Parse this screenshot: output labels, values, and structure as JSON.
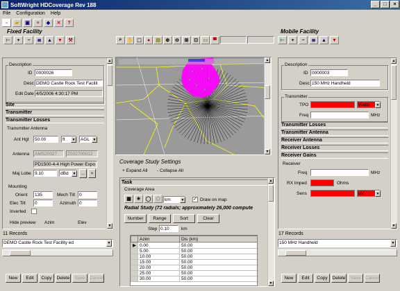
{
  "window": {
    "title": "SoftWright HDCoverage Rev 188"
  },
  "menu": [
    {
      "label": "File"
    },
    {
      "label": "Configuration"
    },
    {
      "label": "Help"
    }
  ],
  "fixed": {
    "title": "Fixed Facility",
    "desc_group": "Description",
    "id_label": "ID",
    "id": "0000026",
    "desc_label": "Desc",
    "desc": "DEMO Castle Rock Test Facilit",
    "edit_label": "Edit Date",
    "edit": "4/5/2006 4:30:17 PM",
    "site": "Site",
    "transmitter": "Transmitter",
    "losses": "Transmitter Losses",
    "antenna_group": "Transmitter Antenna",
    "anthgt_label": "Ant Hgt",
    "anthgt": "50.00",
    "anthgt_unit": "ft",
    "anthgt_ref": "AGL",
    "antenna_label": "Antenna",
    "antenna_a": "AMS20027",
    "antenna_b": "Z002700012",
    "antenna_model": "PD1500-4-4 High Power Expo",
    "majlobe_label": "Maj Lobe",
    "majlobe": "9.10",
    "majlobe_unit": "dBd",
    "mounting": "Mounting",
    "orient_label": "Orient",
    "orient": "135",
    "mechtilt_label": "Mech Tilt",
    "mechtilt": "0",
    "electilt_label": "Elec Tilt",
    "electilt": "0",
    "azimuth_label": "Azimuth",
    "azimuth": "0",
    "inverted": "Inverted",
    "hidepreview": "Hide preview",
    "azim": "Azim",
    "elev": "Elev",
    "records": "11 Records",
    "selected": "DEMO Castle Rock Test Facility ed"
  },
  "mobile": {
    "title": "Mobile Facility",
    "desc_group": "Description",
    "id_label": "ID",
    "id": "0000003",
    "desc_label": "Desc",
    "desc": "150 MHz Handheld",
    "tx_group": "Transmitter",
    "tpo_label": "TPO",
    "tpo_unit": "Watts",
    "freq_label": "Freq",
    "freq_unit": "MHz",
    "tx_losses": "Transmitter Losses",
    "tx_antenna": "Transmitter Antenna",
    "rx_antenna": "Receiver Antenna",
    "rx_losses": "Receiver Losses",
    "rx_gains": "Receiver Gains",
    "rx_group": "Receiver",
    "rxfreq_label": "Freq",
    "rxfreq_unit": "MHz",
    "rximped_label": "RX Imped",
    "rximped_unit": "Ohms",
    "sens_label": "Sens",
    "sens_unit": "uV",
    "records": "17 Records",
    "selected": "150 MHz Handheld"
  },
  "buttons": {
    "new": "New",
    "edit": "Edit",
    "copy": "Copy",
    "delete": "Delete",
    "save": "Save",
    "cancel": "Cancel"
  },
  "study": {
    "title": "Coverage Study Settings",
    "expand": "Expand All",
    "collapse": "Collapse All",
    "task": "Task",
    "area": "Coverage Area",
    "unit": "km",
    "draw": "Draw on map",
    "radial": "Radial Study (72 radials; approximately 26,000 compute",
    "number": "Number",
    "range": "Range",
    "sort": "Sort",
    "clear": "Clear",
    "step_label": "Step",
    "step": "0.10",
    "step_unit": "km",
    "col_azim": "Azim",
    "col_dis": "Dis (km)",
    "rows": [
      [
        "0.00",
        "50.00"
      ],
      [
        "5.00",
        "50.00"
      ],
      [
        "10.00",
        "50.00"
      ],
      [
        "15.00",
        "50.00"
      ],
      [
        "20.00",
        "50.00"
      ],
      [
        "25.00",
        "50.00"
      ],
      [
        "30.00",
        "50.00"
      ]
    ]
  },
  "colors": {
    "title_start": "#0a246a",
    "title_end": "#3a6ea5",
    "required": "#ff0000",
    "coverage": "#ff00ff",
    "boundary": "#ffff00"
  }
}
